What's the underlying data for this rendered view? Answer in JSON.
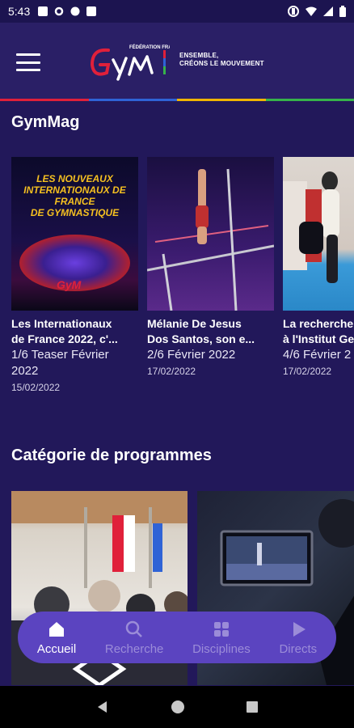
{
  "status_bar": {
    "time": "5:43"
  },
  "header": {
    "logo_word": "GyM",
    "federation": "FÉDÉRATION FRANÇAISE",
    "tagline_line1": "ENSEMBLE,",
    "tagline_line2": "CRÉONS LE MOUVEMENT",
    "rule_colors": [
      "#e0203a",
      "#2f63d6",
      "#f0b400",
      "#36b24a"
    ]
  },
  "gymmag": {
    "title": "GymMag",
    "cards": [
      {
        "title": "Les Internationaux\nde France 2022, c'...",
        "subtitle": "1/6 Teaser Février\n2022",
        "date": "15/02/2022",
        "poster_text": "LES NOUVEAUX\nINTERNATIONAUX DE FRANCE\nDE GYMNASTIQUE"
      },
      {
        "title": "Mélanie De Jesus\nDos Santos, son e...",
        "subtitle": "2/6 Février 2022",
        "date": "17/02/2022"
      },
      {
        "title": "La recherche\nà l'Institut Ge",
        "subtitle": "4/6 Février 2",
        "date": "17/02/2022"
      }
    ]
  },
  "programmes": {
    "title": "Catégorie de programmes"
  },
  "bottom_nav": {
    "items": [
      {
        "label": "Accueil",
        "icon": "home-icon",
        "active": true
      },
      {
        "label": "Recherche",
        "icon": "search-icon",
        "active": false
      },
      {
        "label": "Disciplines",
        "icon": "grid-icon",
        "active": false
      },
      {
        "label": "Directs",
        "icon": "play-icon",
        "active": false
      }
    ]
  }
}
